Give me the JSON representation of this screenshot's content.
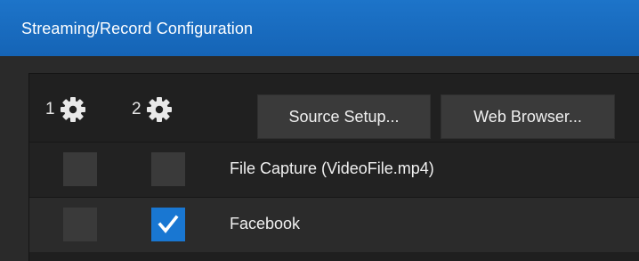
{
  "window": {
    "title": "Streaming/Record Configuration"
  },
  "toolbar": {
    "output1_label": "1",
    "output2_label": "2",
    "source_setup_label": "Source Setup...",
    "web_browser_label": "Web Browser..."
  },
  "outputs": [
    {
      "label": "File Capture (VideoFile.mp4)",
      "output1_checked": false,
      "output2_checked": false
    },
    {
      "label": "Facebook",
      "output1_checked": false,
      "output2_checked": true
    }
  ],
  "colors": {
    "titlebar": "#1a6ec2",
    "accent_checked": "#1977d2",
    "background": "#272727"
  }
}
